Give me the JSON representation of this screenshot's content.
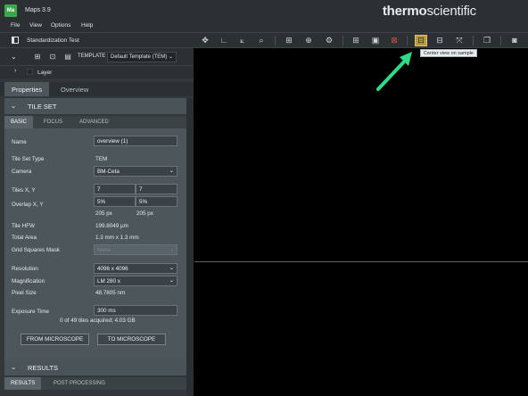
{
  "titlebar": {
    "app_icon": "Ma",
    "title": "Maps 3.9",
    "brand_bold": "thermo",
    "brand_light": "scientific"
  },
  "menu": {
    "file": "File",
    "view": "View",
    "options": "Options",
    "help": "Help"
  },
  "toolbar": {
    "project_name": "Standardization Test",
    "icons": [
      "move-icon",
      "ruler-icon",
      "angle-icon",
      "zoom-icon",
      "grid-icon",
      "atlas-icon",
      "settings-icon",
      "add-icon",
      "export-icon",
      "screenshot-icon",
      "center-view-icon",
      "fit-icon",
      "full-extent-icon",
      "window-icon",
      "camera-icon"
    ],
    "active_color": "#b89b3c"
  },
  "template": {
    "label": "TEMPLATE",
    "value": "Default Template (TEM)"
  },
  "layer": {
    "label": "Layer"
  },
  "tabs": {
    "properties": "Properties",
    "overview": "Overview"
  },
  "tileset": {
    "header": "TILE SET",
    "subtabs": [
      "BASIC",
      "FOCUS",
      "ADVANCED"
    ],
    "name_label": "Name",
    "name_value": "overview (1)",
    "type_label": "Tile Set Type",
    "type_value": "TEM",
    "camera_label": "Camera",
    "camera_value": "BM-Ceta",
    "tiles_label": "Tiles X, Y",
    "tiles_x": "7",
    "tiles_y": "7",
    "overlap_label": "Overlap X, Y",
    "overlap_x": "5%",
    "overlap_y": "5%",
    "overlap_px_x": "205 px",
    "overlap_px_y": "205 px",
    "hfw_label": "Tile HFW",
    "hfw_value": "199.8049 µm",
    "area_label": "Total Area",
    "area_value": "1.3 mm x 1.3 mm",
    "mask_label": "Grid Squares Mask",
    "mask_value": "None",
    "resolution_label": "Resolution",
    "resolution_value": "4096 x 4096",
    "magnification_label": "Magnification",
    "magnification_value": "LM 280 x",
    "pixel_label": "Pixel Size",
    "pixel_value": "48.7805 nm",
    "exposure_label": "Exposure Time",
    "exposure_value": "300 ms",
    "status": "0 of 49 tiles acquired; 4.03 GB",
    "from_button": "FROM MICROSCOPE",
    "to_button": "TO MICROSCOPE"
  },
  "results": {
    "header": "RESULTS",
    "subtabs": [
      "RESULTS",
      "POST PROCESSING"
    ]
  },
  "tooltip": {
    "text": "Center view on sample"
  },
  "annotation": {
    "arrow_color": "#2fdc86"
  }
}
